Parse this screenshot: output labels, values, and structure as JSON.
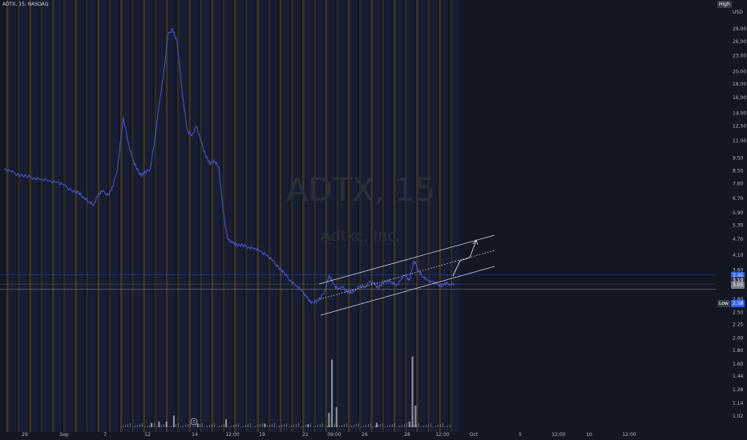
{
  "header": {
    "symbol": "ADTX, 15, NASDAQ"
  },
  "watermark": {
    "ticker": "ADTX, 15",
    "company": "Adtxc, Inc."
  },
  "price_axis": {
    "currency": "USD",
    "high_badge": "High",
    "low_badge": "Low",
    "low_value": "2.58",
    "current_value_a": "3.45",
    "current_value_b": "3.19",
    "current_value_c": "3.05"
  },
  "colors": {
    "background": "#131722",
    "price_line": "#4b56c8",
    "volume": "#b0b3b8",
    "session_orange": "#6b4a1f",
    "session_blue": "#1b2a55",
    "channel": "#d1d4dc",
    "badge_blue": "#2962ff",
    "badge_dark": "#363a45"
  },
  "chart_data": {
    "type": "line",
    "scale": "log",
    "y_ticks": [
      "29.00",
      "26.00",
      "23.00",
      "20.00",
      "18.00",
      "16.00",
      "14.00",
      "12.50",
      "11.00",
      "9.50",
      "8.50",
      "7.60",
      "6.70",
      "5.90",
      "5.30",
      "4.70",
      "4.10",
      "3.60",
      "3.20",
      "2.80",
      "2.50",
      "2.25",
      "2.00",
      "1.80",
      "1.60",
      "1.44",
      "1.28",
      "1.14",
      "1.02"
    ],
    "x_ticks": [
      "29",
      "Sep",
      "7",
      "12",
      "14",
      "12:00",
      "19",
      "21",
      "09:00",
      "26",
      "28",
      "12:00",
      "Oct",
      "5",
      "12:00",
      "10",
      "12:00"
    ],
    "ylim": [
      1.0,
      33.0
    ],
    "series": [
      {
        "x": [
          0,
          0.5,
          1,
          1.5,
          2,
          2.5,
          3,
          3.5,
          4,
          4.5,
          5,
          5.3,
          5.7,
          6,
          6.3,
          6.6,
          7,
          7.3,
          7.6,
          8,
          8.3,
          8.6,
          8.9,
          9.2,
          9.5,
          9.8,
          10.1,
          10.4,
          10.7,
          11,
          11.3,
          11.6,
          12,
          12.3,
          12.6,
          12.9,
          13.2,
          13.5,
          13.8,
          14.1,
          14.4,
          14.7,
          15,
          15.3,
          15.6,
          16,
          16.4,
          16.8,
          17.2,
          17.6,
          18,
          18.4,
          18.8,
          19.2,
          19.6,
          20,
          20.3,
          20.6,
          20.9,
          21.2,
          21.5,
          21.8,
          22.1,
          22.4,
          22.7,
          23,
          23.3,
          23.6,
          23.9,
          24.2,
          24.5,
          24.8,
          25.1,
          25.4,
          25.7,
          26,
          26.3,
          26.6,
          26.9,
          27.2,
          27.5,
          27.8,
          28.1,
          28.4,
          28.7,
          29,
          29.3,
          29.6,
          29.9,
          30.2
        ],
        "values": [
          8.6,
          8.4,
          8.2,
          8.1,
          8.0,
          7.9,
          7.8,
          7.7,
          7.5,
          7.2,
          7.0,
          6.8,
          6.5,
          6.3,
          6.9,
          7.1,
          6.9,
          7.4,
          8.6,
          13.5,
          11.0,
          9.5,
          8.6,
          8.2,
          8.4,
          8.6,
          11.0,
          15.0,
          19.5,
          27.5,
          29.0,
          26.0,
          16.0,
          12.0,
          11.5,
          12.5,
          11.0,
          9.8,
          9.0,
          9.3,
          8.8,
          6.0,
          4.7,
          4.55,
          4.5,
          4.45,
          4.4,
          4.35,
          4.25,
          4.1,
          3.9,
          3.7,
          3.5,
          3.3,
          3.15,
          3.0,
          2.85,
          2.7,
          2.75,
          2.8,
          3.0,
          3.45,
          3.2,
          3.05,
          3.1,
          3.0,
          2.95,
          3.05,
          3.15,
          3.1,
          3.25,
          3.2,
          3.1,
          3.2,
          3.3,
          3.25,
          3.15,
          3.3,
          3.45,
          3.3,
          3.9,
          3.6,
          3.4,
          3.3,
          3.25,
          3.2,
          3.15,
          3.2,
          3.2,
          3.2
        ]
      }
    ],
    "volume": {
      "x": [
        9.9,
        10.4,
        10.9,
        11.4,
        13.0,
        14.9,
        17.5,
        20.4,
        21.8,
        22.0,
        22.3,
        25.0,
        27.2,
        27.4,
        27.6
      ],
      "values": [
        6,
        8,
        8,
        16,
        5,
        11,
        5,
        4,
        20,
        94,
        28,
        6,
        8,
        98,
        30
      ]
    }
  }
}
